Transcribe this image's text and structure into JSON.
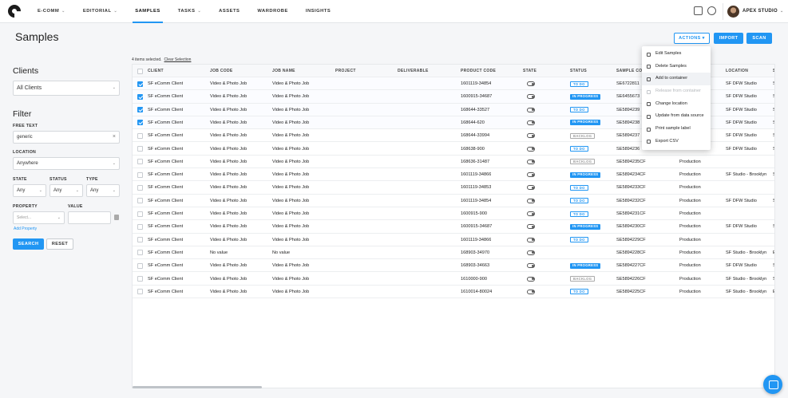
{
  "nav": {
    "links": [
      {
        "label": "E-COMM",
        "chev": "⌄"
      },
      {
        "label": "EDITORIAL",
        "chev": "⌄"
      },
      {
        "label": "SAMPLES",
        "chev": ""
      },
      {
        "label": "TASKS",
        "chev": "⌄"
      },
      {
        "label": "ASSETS",
        "chev": ""
      },
      {
        "label": "WARDROBE",
        "chev": ""
      },
      {
        "label": "INSIGHTS",
        "chev": ""
      }
    ],
    "active": "SAMPLES",
    "user": "APEX STUDIO",
    "user_chev": "⌄"
  },
  "page": {
    "title": "Samples",
    "actions_label": "ACTIONS",
    "actions_chev": "▾",
    "import_label": "IMPORT",
    "scan_label": "SCAN"
  },
  "filters": {
    "clients_title": "Clients",
    "clients_value": "All Clients",
    "filter_title": "Filter",
    "free_text_label": "FREE TEXT",
    "free_text_value": "generic",
    "clear_glyph": "×",
    "location_label": "LOCATION",
    "location_value": "Anywhere",
    "state_label": "STATE",
    "state_value": "Any",
    "status_label": "STATUS",
    "status_value": "Any",
    "type_label": "TYPE",
    "type_value": "Any",
    "property_label": "PROPERTY",
    "property_placeholder": "Select...",
    "value_label": "VALUE",
    "add_property": "Add Property",
    "search_label": "SEARCH",
    "reset_label": "RESET",
    "caret": "⌄"
  },
  "table": {
    "selection_text": "4 items selected.",
    "clear_selection": "Clear Selection",
    "columns": [
      "CLIENT",
      "JOB CODE",
      "JOB NAME",
      "PROJECT",
      "DELIVERABLE",
      "PRODUCT CODE",
      "STATE",
      "STATUS",
      "SAMPLE CODE",
      "",
      "LOCATION",
      "S"
    ],
    "rows": [
      {
        "checked": true,
        "client": "SF eComm Client",
        "job_code": "Video & Photo Job",
        "job_name": "Video & Photo Job",
        "product_code": "1601119-34854",
        "status": "TO DO",
        "status_type": "todo",
        "sample_code": "SE6722811",
        "type": "",
        "location": "SF DFW Studio",
        "s": "S"
      },
      {
        "checked": true,
        "client": "SF eComm Client",
        "job_code": "Video & Photo Job",
        "job_name": "Video & Photo Job",
        "product_code": "1600915-34687",
        "status": "IN PROGRESS",
        "status_type": "prog",
        "sample_code": "SE6455673",
        "type": "",
        "location": "SF DFW Studio",
        "s": "S"
      },
      {
        "checked": true,
        "client": "SF eComm Client",
        "job_code": "Video & Photo Job",
        "job_name": "Video & Photo Job",
        "product_code": "168644-33527",
        "status": "TO DO",
        "status_type": "todo",
        "sample_code": "SE5894239",
        "type": "",
        "location": "SF DFW Studio",
        "s": "S"
      },
      {
        "checked": true,
        "client": "SF eComm Client",
        "job_code": "Video & Photo Job",
        "job_name": "Video & Photo Job",
        "product_code": "168644-620",
        "status": "IN PROGRESS",
        "status_type": "prog",
        "sample_code": "SE5894238",
        "type": "",
        "location": "SF DFW Studio",
        "s": "S"
      },
      {
        "checked": false,
        "client": "SF eComm Client",
        "job_code": "Video & Photo Job",
        "job_name": "Video & Photo Job",
        "product_code": "168644-33994",
        "status": "BACKLOG",
        "status_type": "back",
        "sample_code": "SE5894237",
        "type": "",
        "location": "SF DFW Studio",
        "s": "S"
      },
      {
        "checked": false,
        "client": "SF eComm Client",
        "job_code": "Video & Photo Job",
        "job_name": "Video & Photo Job",
        "product_code": "168638-900",
        "status": "TO DO",
        "status_type": "todo",
        "sample_code": "SE5894236",
        "type": "",
        "location": "SF DFW Studio",
        "s": "S"
      },
      {
        "checked": false,
        "client": "SF eComm Client",
        "job_code": "Video & Photo Job",
        "job_name": "Video & Photo Job",
        "product_code": "168636-31487",
        "status": "BACKLOG",
        "status_type": "back",
        "sample_code": "SE5894235CF",
        "type": "Production",
        "location": "",
        "s": ""
      },
      {
        "checked": false,
        "client": "SF eComm Client",
        "job_code": "Video & Photo Job",
        "job_name": "Video & Photo Job",
        "product_code": "1601119-34866",
        "status": "IN PROGRESS",
        "status_type": "prog",
        "sample_code": "SE5894234CF",
        "type": "Production",
        "location": "SF Studio - Brooklyn",
        "s": "S"
      },
      {
        "checked": false,
        "client": "SF eComm Client",
        "job_code": "Video & Photo Job",
        "job_name": "Video & Photo Job",
        "product_code": "1601119-34853",
        "status": "TO DO",
        "status_type": "todo",
        "sample_code": "SE5894233CF",
        "type": "Production",
        "location": "",
        "s": ""
      },
      {
        "checked": false,
        "client": "SF eComm Client",
        "job_code": "Video & Photo Job",
        "job_name": "Video & Photo Job",
        "product_code": "1601119-34854",
        "status": "TO DO",
        "status_type": "todo",
        "sample_code": "SE5894232CF",
        "type": "Production",
        "location": "SF DFW Studio",
        "s": "S"
      },
      {
        "checked": false,
        "client": "SF eComm Client",
        "job_code": "Video & Photo Job",
        "job_name": "Video & Photo Job",
        "product_code": "1600915-900",
        "status": "TO DO",
        "status_type": "todo",
        "sample_code": "SE5894231CF",
        "type": "Production",
        "location": "",
        "s": ""
      },
      {
        "checked": false,
        "client": "SF eComm Client",
        "job_code": "Video & Photo Job",
        "job_name": "Video & Photo Job",
        "product_code": "1600915-34687",
        "status": "IN PROGRESS",
        "status_type": "prog",
        "sample_code": "SE5894230CF",
        "type": "Production",
        "location": "SF DFW Studio",
        "s": "S"
      },
      {
        "checked": false,
        "client": "SF eComm Client",
        "job_code": "Video & Photo Job",
        "job_name": "Video & Photo Job",
        "product_code": "1601119-34866",
        "status": "TO DO",
        "status_type": "todo",
        "sample_code": "SE5894229CF",
        "type": "Production",
        "location": "",
        "s": ""
      },
      {
        "checked": false,
        "client": "SF eComm Client",
        "job_code": "No value",
        "job_name": "No value",
        "product_code": "168903-34970",
        "status": "",
        "status_type": "",
        "sample_code": "SE5894228CF",
        "type": "Production",
        "location": "SF Studio - Brooklyn",
        "s": "E"
      },
      {
        "checked": false,
        "client": "SF eComm Client",
        "job_code": "Video & Photo Job",
        "job_name": "Video & Photo Job",
        "product_code": "168903-34663",
        "status": "IN PROGRESS",
        "status_type": "prog",
        "sample_code": "SE5894227CF",
        "type": "Production",
        "location": "SF DFW Studio",
        "s": "S"
      },
      {
        "checked": false,
        "client": "SF eComm Client",
        "job_code": "Video & Photo Job",
        "job_name": "Video & Photo Job",
        "product_code": "1610000-900",
        "status": "BACKLOG",
        "status_type": "back",
        "sample_code": "SE5894226CF",
        "type": "Production",
        "location": "SF Studio - Brooklyn",
        "s": "S"
      },
      {
        "checked": false,
        "client": "SF eComm Client",
        "job_code": "Video & Photo Job",
        "job_name": "Video & Photo Job",
        "product_code": "1610014-80024",
        "status": "TO DO",
        "status_type": "todo",
        "sample_code": "SE5894225CF",
        "type": "Production",
        "location": "SF Studio - Brooklyn",
        "s": "E"
      }
    ]
  },
  "menu": {
    "items": [
      {
        "label": "Edit Samples",
        "icon": "pencil-icon",
        "disabled": false,
        "hover": false
      },
      {
        "label": "Delete Samples",
        "icon": "trash-icon",
        "disabled": false,
        "hover": false
      },
      {
        "label": "Add to container",
        "icon": "container-icon",
        "disabled": false,
        "hover": true
      },
      {
        "label": "Release from container",
        "icon": "release-icon",
        "disabled": true,
        "hover": false
      },
      {
        "label": "Change location",
        "icon": "location-icon",
        "disabled": false,
        "hover": false
      },
      {
        "label": "Update from data source",
        "icon": "refresh-icon",
        "disabled": false,
        "hover": false
      },
      {
        "label": "Print sample label",
        "icon": "print-icon",
        "disabled": false,
        "hover": false
      },
      {
        "label": "Export CSV",
        "icon": "export-icon",
        "disabled": false,
        "hover": false
      }
    ]
  },
  "colors": {
    "accent": "#2196f3"
  }
}
